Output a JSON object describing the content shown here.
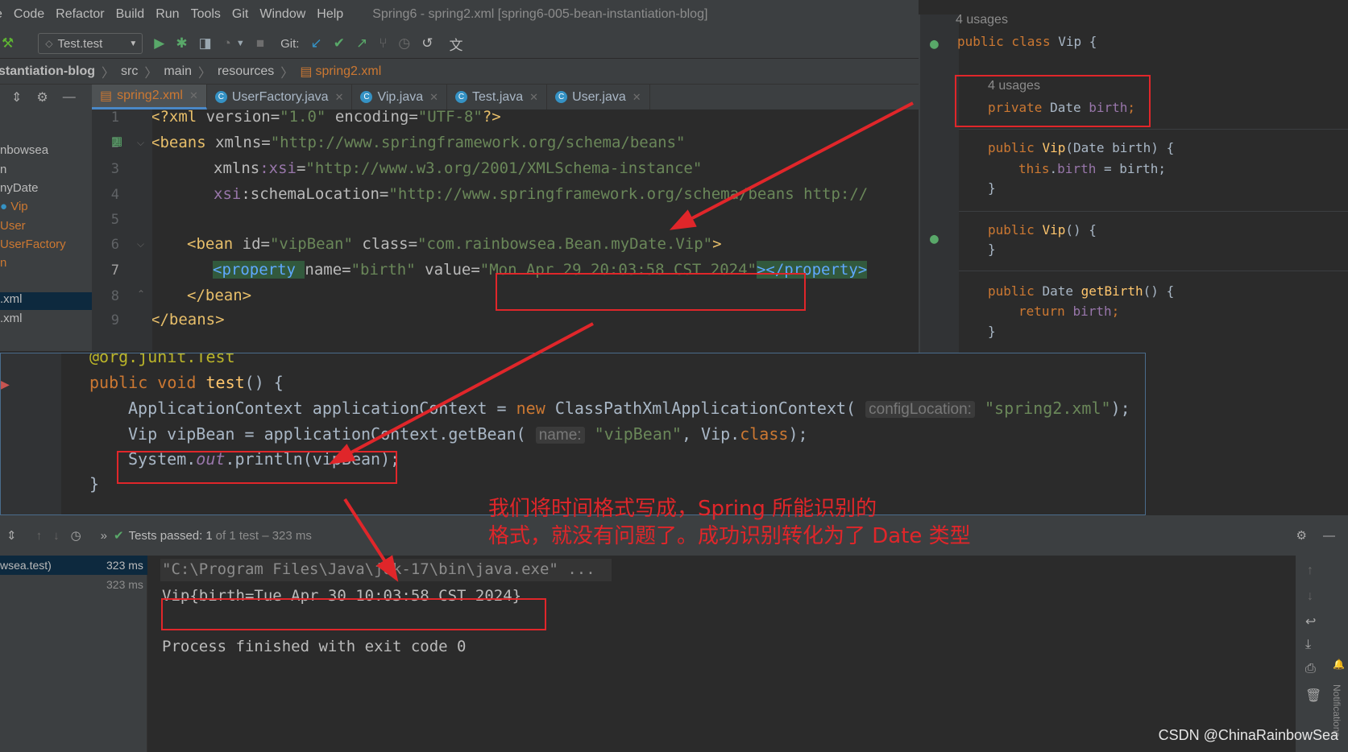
{
  "menu": {
    "items": [
      "e",
      "Code",
      "Refactor",
      "Build",
      "Run",
      "Tools",
      "Git",
      "Window",
      "Help"
    ],
    "window_title": "Spring6 - spring2.xml [spring6-005-bean-instantiation-blog]"
  },
  "toolbar": {
    "run_config": "Test.test",
    "git_label": "Git:"
  },
  "breadcrumb": [
    "stantiation-blog",
    "src",
    "main",
    "resources",
    "spring2.xml"
  ],
  "tabs": [
    {
      "label": "spring2.xml",
      "active": true
    },
    {
      "label": "UserFactory.java",
      "active": false
    },
    {
      "label": "Vip.java",
      "active": false
    },
    {
      "label": "Test.java",
      "active": false
    },
    {
      "label": "User.java",
      "active": false
    }
  ],
  "project_tree": [
    "nbowsea",
    "n",
    "nyDate",
    "Vip",
    "User",
    "UserFactory",
    "n",
    ".xml",
    ".xml"
  ],
  "xml_editor": {
    "line_numbers": [
      "1",
      "2",
      "3",
      "4",
      "5",
      "6",
      "7",
      "8",
      "9"
    ],
    "l1": {
      "a": "<?xml ",
      "b": "version",
      "c": "=",
      "d": "\"1.0\"",
      "e": " encoding",
      "f": "=",
      "g": "\"UTF-8\"",
      "h": "?>"
    },
    "l2": {
      "a": "<beans ",
      "b": "xmlns",
      "c": "=",
      "d": "\"http://www.springframework.org/schema/beans\""
    },
    "l3": {
      "a": "xmlns",
      "b": ":xsi",
      "c": "=",
      "d": "\"http://www.w3.org/2001/XMLSchema-instance\""
    },
    "l4": {
      "a": "xsi",
      "b": ":schemaLocation",
      "c": "=",
      "d": "\"http://www.springframework.org/schema/beans http://"
    },
    "l6": {
      "a": "<bean ",
      "b": "id",
      "c": "=",
      "d": "\"vipBean\"",
      "e": " class",
      "f": "=",
      "g": "\"com.rainbowsea.Bean.myDate.Vip\"",
      "h": ">"
    },
    "l7": {
      "a": "<property ",
      "b": "name",
      "c": "=",
      "d": "\"birth\"",
      "e": " value",
      "f": "=",
      "g": "\"Mon Apr 29 20:03:58 CST 2024\"",
      "h": "></property>"
    },
    "l8": "</bean>",
    "l9": "</beans>"
  },
  "vip_class": {
    "usages1": "4 usages",
    "class_kw": "public class ",
    "class_name": "Vip",
    "class_brace": " {",
    "usages2": "4 usages",
    "field_kw": "private ",
    "field_type": "Date ",
    "field_name": "birth",
    "field_end": ";",
    "ctor1_kw": "public ",
    "ctor1_name": "Vip",
    "ctor1_params": "(Date birth) {",
    "ctor1_this": "this",
    "ctor1_dot": ".",
    "ctor1_field": "birth",
    "ctor1_rest": " = birth;",
    "close1": "}",
    "ctor2_kw": "public ",
    "ctor2_name": "Vip",
    "ctor2_rest": "() {",
    "close2": "}",
    "getter_kw": "public ",
    "getter_type": "Date ",
    "getter_name": "getBirth",
    "getter_rest": "() {",
    "return_kw": "return ",
    "return_field": "birth",
    "return_end": ";",
    "close3": "}"
  },
  "test_editor": {
    "annotation": "@org.junit.Test",
    "sig_kw": "public void ",
    "sig_name": "test",
    "sig_rest": "() {",
    "l1_a": "ApplicationContext applicationContext = ",
    "l1_new": "new ",
    "l1_b": "ClassPathXmlApplicationContext(",
    "l1_hint": "configLocation:",
    "l1_str": "\"spring2.xml\"",
    "l1_end": ");",
    "l2_a": "Vip vipBean = applicationContext.getBean(",
    "l2_hint": "name:",
    "l2_str": "\"vipBean\"",
    "l2_b": ", Vip.",
    "l2_cls": "class",
    "l2_end": ");",
    "l3_a": "System.",
    "l3_out": "out",
    "l3_b": ".println(vipBean);",
    "close": "}"
  },
  "run_panel": {
    "tests_passed": "Tests passed:",
    "tests_count": "1",
    "tests_detail": "of 1 test – 323 ms",
    "tree_item": "wsea.test)",
    "tree_time1": "323 ms",
    "tree_time2": "323 ms",
    "console_cmd": "\"C:\\Program Files\\Java\\jdk-17\\bin\\java.exe\" ...",
    "console_out": "Vip{birth=Tue Apr 30 10:03:58 CST 2024}",
    "console_exit": "Process finished with exit code 0",
    "notifications": "Notifications"
  },
  "annotation_note": {
    "line1": "我们将时间格式写成，Spring 所能识别的",
    "line2": "格式，就没有问题了。成功识别转化为了 Date 类型"
  },
  "watermark": "CSDN @ChinaRainbowSea",
  "colors": {
    "highlight_red": "#e0262a",
    "accent_blue": "#4a88c7"
  }
}
